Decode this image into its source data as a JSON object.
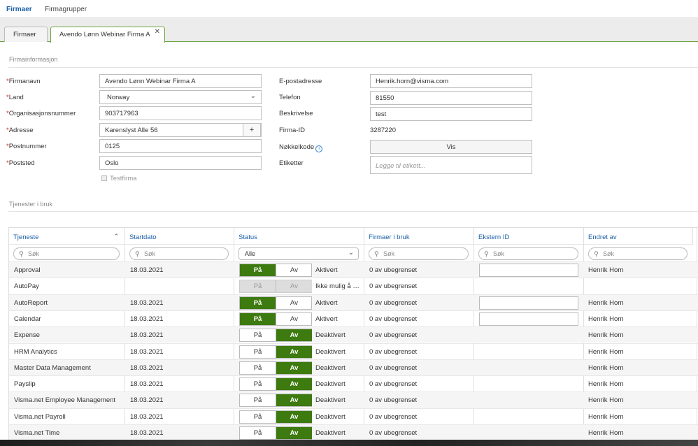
{
  "nav": {
    "items": [
      "Firmaer",
      "Firmagrupper"
    ]
  },
  "tabs": [
    {
      "label": "Firmaer"
    },
    {
      "label": "Avendo Lønn Webinar Firma A",
      "close": "✕"
    }
  ],
  "firm_section": "Firmainformasjon",
  "left_fields": [
    {
      "label": "Firmanavn",
      "value": "Avendo Lønn Webinar Firma A"
    },
    {
      "label": "Land",
      "value": "Norway"
    },
    {
      "label": "Organisasjonsnummer",
      "value": "903717963"
    },
    {
      "label": "Adresse",
      "value": "Karenslyst Alle 56"
    },
    {
      "label": "Postnummer",
      "value": "0125"
    },
    {
      "label": "Poststed",
      "value": "Oslo"
    }
  ],
  "req_mark": "*",
  "add_glyph": "+",
  "testfirma_label": "Testfirma",
  "right_fields": {
    "email_label": "E-postadresse",
    "email_value": "Henrik.horn@visma.com",
    "phone_label": "Telefon",
    "phone_value": "81550",
    "desc_label": "Beskrivelse",
    "desc_value": "test",
    "firmid_label": "Firma-ID",
    "firmid_value": "3287220",
    "key_label": "Nøkkelkode",
    "key_button": "Vis",
    "tags_label": "Etiketter",
    "tags_placeholder": "Legge til etikett..."
  },
  "services_section": "Tjenester i bruk",
  "grid": {
    "columns": [
      "Tjeneste",
      "Startdato",
      "Status",
      "Firmaer i bruk",
      "Ekstern ID",
      "Endret av"
    ],
    "search_placeholder": "Søk",
    "status_filter": "Alle",
    "on_label": "På",
    "off_label": "Av",
    "rows": [
      {
        "service": "Approval",
        "date": "18.03.2021",
        "state": "on",
        "status": "Aktivert",
        "firms": "0 av ubegrenset",
        "ext": true,
        "by": "Henrik Horn"
      },
      {
        "service": "AutoPay",
        "date": "",
        "state": "disabled",
        "status": "Ikke mulig å …",
        "firms": "0 av ubegrenset",
        "ext": false,
        "by": ""
      },
      {
        "service": "AutoReport",
        "date": "18.03.2021",
        "state": "on",
        "status": "Aktivert",
        "firms": "0 av ubegrenset",
        "ext": true,
        "by": "Henrik Horn"
      },
      {
        "service": "Calendar",
        "date": "18.03.2021",
        "state": "on",
        "status": "Aktivert",
        "firms": "0 av ubegrenset",
        "ext": true,
        "by": "Henrik Horn"
      },
      {
        "service": "Expense",
        "date": "18.03.2021",
        "state": "off",
        "status": "Deaktivert",
        "firms": "0 av ubegrenset",
        "ext": false,
        "by": "Henrik Horn"
      },
      {
        "service": "HRM Analytics",
        "date": "18.03.2021",
        "state": "off",
        "status": "Deaktivert",
        "firms": "0 av ubegrenset",
        "ext": false,
        "by": "Henrik Horn"
      },
      {
        "service": "Master Data Management",
        "date": "18.03.2021",
        "state": "off",
        "status": "Deaktivert",
        "firms": "0 av ubegrenset",
        "ext": false,
        "by": "Henrik Horn"
      },
      {
        "service": "Payslip",
        "date": "18.03.2021",
        "state": "off",
        "status": "Deaktivert",
        "firms": "0 av ubegrenset",
        "ext": false,
        "by": "Henrik Horn"
      },
      {
        "service": "Visma.net Employee Management",
        "date": "18.03.2021",
        "state": "off",
        "status": "Deaktivert",
        "firms": "0 av ubegrenset",
        "ext": false,
        "by": "Henrik Horn"
      },
      {
        "service": "Visma.net Payroll",
        "date": "18.03.2021",
        "state": "off",
        "status": "Deaktivert",
        "firms": "0 av ubegrenset",
        "ext": false,
        "by": "Henrik Horn"
      },
      {
        "service": "Visma.net Time",
        "date": "18.03.2021",
        "state": "off",
        "status": "Deaktivert",
        "firms": "0 av ubegrenset",
        "ext": false,
        "by": "Henrik Horn"
      }
    ]
  },
  "colors": {
    "accent": "#1a5fa8",
    "active_green": "#3d7a0f",
    "tab_border": "#6aa33c",
    "required": "#dd2222"
  }
}
